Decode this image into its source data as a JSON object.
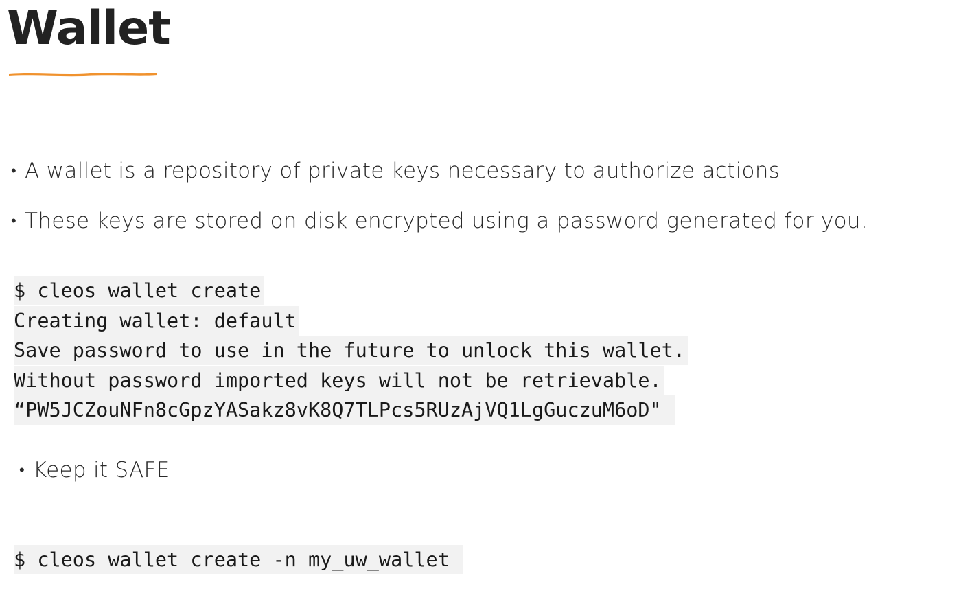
{
  "title": "Wallet",
  "colors": {
    "accent_underline": "#f0922e",
    "code_background": "#f2f2f2"
  },
  "bullets": {
    "b1": "A wallet is a repository of private keys necessary to authorize actions",
    "b2": "These keys are stored on disk encrypted using a password generated for you.",
    "b3": "Keep it SAFE",
    "marker": "•"
  },
  "code1": [
    "$ cleos wallet create",
    "Creating wallet: default",
    "Save password to use in the future to unlock this wallet.",
    "Without password imported keys will not be retrievable.",
    "“PW5JCZouNFn8cGpzYASakz8vK8Q7TLPcs5RUzAjVQ1LgGuczuM6oD\""
  ],
  "code2": [
    "$ cleos wallet create -n my_uw_wallet"
  ]
}
